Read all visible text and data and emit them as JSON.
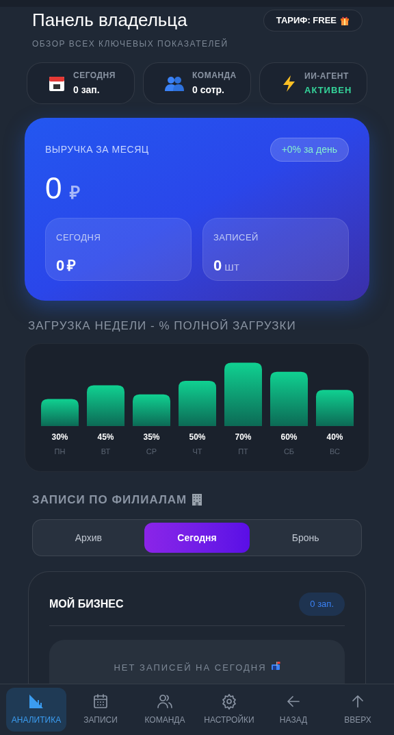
{
  "header": {
    "title": "Панель владельца",
    "subtitle": "ОБЗОР ВСЕХ КЛЮЧЕВЫХ ПОКАЗАТЕЛЕЙ",
    "plan_badge": "ТАРИФ: FREE"
  },
  "stats": [
    {
      "kind": "calendar",
      "label": "СЕГОДНЯ",
      "value": "0 зап.",
      "highlight": false
    },
    {
      "kind": "team",
      "label": "КОМАНДА",
      "value": "0 сотр.",
      "highlight": false
    },
    {
      "kind": "agent",
      "label": "ИИ-АГЕНТ",
      "value": "АКТИВЕН",
      "highlight": true
    }
  ],
  "revenue": {
    "title": "ВЫРУЧКА ЗА МЕСЯЦ",
    "change": "+0% за день",
    "amount": "0",
    "currency": "₽",
    "tiles": [
      {
        "label": "СЕГОДНЯ",
        "value": "0",
        "unit": "₽",
        "kind": "money"
      },
      {
        "label": "ЗАПИСЕЙ",
        "value": "0",
        "unit": "шт",
        "kind": "count"
      }
    ]
  },
  "weekly_load": {
    "title": "ЗАГРУЗКА НЕДЕЛИ - % ПОЛНОЙ ЗАГРУЗКИ",
    "chart_data": {
      "type": "bar",
      "categories": [
        "ПН",
        "ВТ",
        "СР",
        "ЧТ",
        "ПТ",
        "СБ",
        "ВС"
      ],
      "values": [
        30,
        45,
        35,
        50,
        70,
        60,
        40
      ],
      "value_labels": [
        "30%",
        "45%",
        "35%",
        "50%",
        "70%",
        "60%",
        "40%"
      ]
    }
  },
  "branches": {
    "title": "ЗАПИСИ ПО ФИЛИАЛАМ",
    "tabs": [
      {
        "label": "Архив",
        "selected": false
      },
      {
        "label": "Сегодня",
        "selected": true
      },
      {
        "label": "Бронь",
        "selected": false
      }
    ],
    "cards": [
      {
        "name": "МОЙ БИЗНЕС",
        "count": "0 зап.",
        "empty_text": "НЕТ ЗАПИСЕЙ НА СЕГОДНЯ"
      }
    ]
  },
  "bottom_nav": [
    {
      "kind": "analytics",
      "label": "АНАЛИТИКА",
      "selected": true
    },
    {
      "kind": "calendar",
      "label": "ЗАПИСИ",
      "selected": false
    },
    {
      "kind": "team",
      "label": "КОМАНДА",
      "selected": false
    },
    {
      "kind": "settings",
      "label": "НАСТРОЙКИ",
      "selected": false
    },
    {
      "kind": "back",
      "label": "НАЗАД",
      "selected": false
    },
    {
      "kind": "up",
      "label": "ВВЕРХ",
      "selected": false
    }
  ]
}
